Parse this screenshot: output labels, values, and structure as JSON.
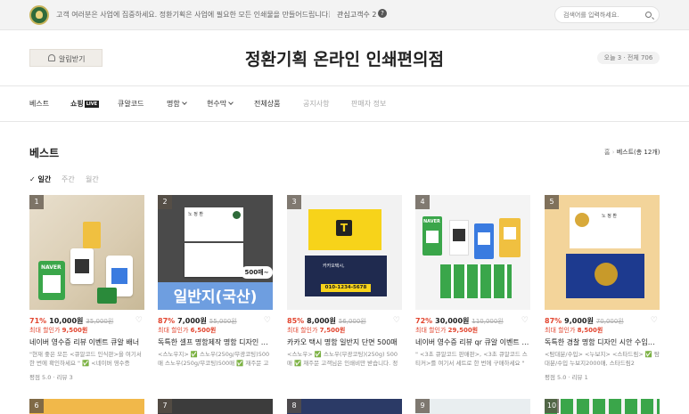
{
  "topbar": {
    "notice": "고객 여러분은 사업에 집중하세요. 정환기획은 사업에 필요한 모든 인쇄물을 만들어드립니다.",
    "separator": "|",
    "interest": "관심고객수 2",
    "help_icon": "?",
    "search_placeholder": "검색어를 입력하세요."
  },
  "header": {
    "alarm_label": "알림받기",
    "title": "정환기획 온라인 인쇄편의점",
    "visits": "오늘 3 · 전체 706"
  },
  "nav": {
    "items": [
      "베스트",
      "쇼핑",
      "큐알코드",
      "명함",
      "현수막",
      "전체상품",
      "공지사항",
      "판매자 정보"
    ],
    "live_badge": "LIVE"
  },
  "section": {
    "title": "베스트",
    "home": "홈",
    "breadcrumb": "베스트(총 12개)",
    "periods": [
      "일간",
      "주간",
      "월간"
    ]
  },
  "products": [
    {
      "rank": "1",
      "discount": "71%",
      "price": "10,000원",
      "original": "35,000원",
      "max_label": "최대 할인가",
      "max_price": "9,500원",
      "name": "네이버 영수증 리뷰 이벤트 큐알 배너",
      "desc": "\"현재 좋은 모든 <큐알코드 인식판>을 여기서 한 번에 확인하세요 \" ✅ <네이버 영수증",
      "review": "평점 5.0 · 리뷰 3"
    },
    {
      "rank": "2",
      "discount": "87%",
      "price": "7,000원",
      "original": "55,000원",
      "max_label": "최대 할인가",
      "max_price": "6,500원",
      "name": "독특한 셀프 명함제작 명함 디자인 시안 수정",
      "desc": "<스노우지> ✅ 스노우(250g/무광코팅)500매 스노우(250g/무코팅)500매 ✅ 재주문 고객",
      "review": ""
    },
    {
      "rank": "3",
      "discount": "85%",
      "price": "8,000원",
      "original": "56,000원",
      "max_label": "최대 할인가",
      "max_price": "7,500원",
      "name": "카카오 택시 명함 일반지 단면 500매",
      "desc": "<스노우> ✅ 스노우(무광코팅)(250g) 500매 ✅ 재주문 고객님은 인쇄비만 받습니다. 정",
      "review": ""
    },
    {
      "rank": "4",
      "discount": "72%",
      "price": "30,000원",
      "original": "110,000원",
      "max_label": "최대 할인가",
      "max_price": "29,500원",
      "name": "네이버 영수증 리뷰 qr 큐알 이벤트 배너 스탠드",
      "desc": "\" <3초 큐알코드 판매판>, <3초 큐알코드 스티커>를 여기서 세트로 한 번에 구매하세요 \"",
      "review": ""
    },
    {
      "rank": "5",
      "discount": "87%",
      "price": "9,000원",
      "original": "70,000원",
      "max_label": "최대 할인가",
      "max_price": "8,500원",
      "name": "독특한 경찰 명함 디자인 시안 수입지 단면",
      "desc": "<탐대분/수입> <누보지> <스타드림> ✅ 탐대분/수입 누보지2000매, 스타드림2",
      "review": "평점 5.0 · 리뷰 1"
    }
  ],
  "row2_ranks": [
    "6",
    "7",
    "8",
    "9",
    "10"
  ],
  "thumb_text": {
    "t2_main": "일반지(국산)",
    "t2_badge": "500매~",
    "t2_name": "노 정 환",
    "t3_name": "카카오택시,",
    "t3_phone": "010-1234-5678",
    "t4_brand": "NAVER",
    "t5_name": "노 정 환",
    "t1_brand": "NAVER"
  }
}
